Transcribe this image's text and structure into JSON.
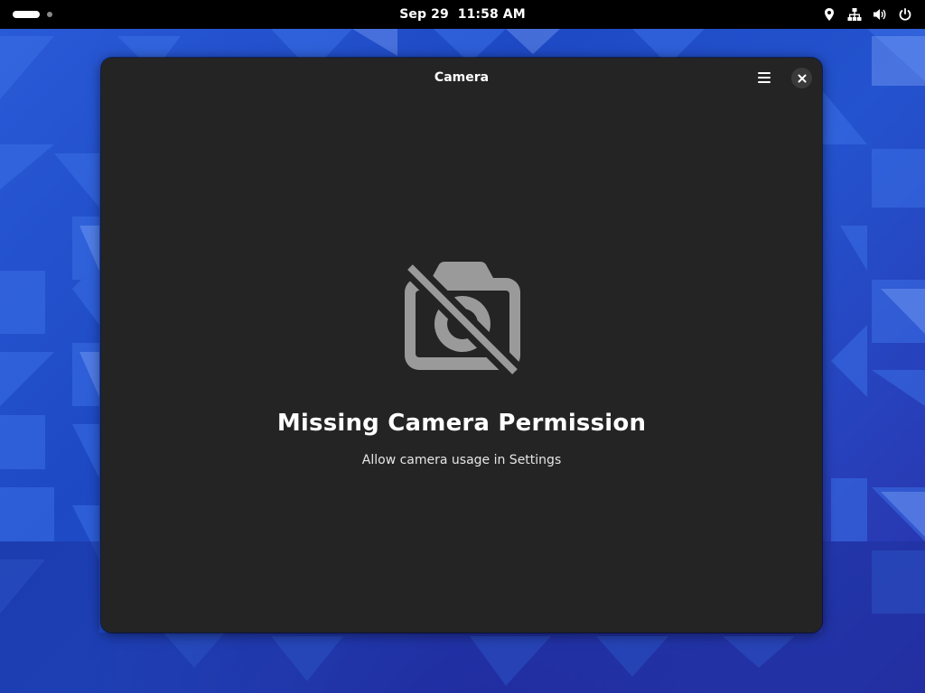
{
  "topbar": {
    "date": "Sep 29",
    "time": "11:58 AM",
    "tray_icons": [
      "location-icon",
      "network-wired-icon",
      "volume-icon",
      "power-icon"
    ]
  },
  "window": {
    "title": "Camera",
    "menu_icon": "hamburger-menu-icon",
    "close_icon": "close-icon"
  },
  "status": {
    "icon": "camera-disabled-icon",
    "title": "Missing Camera Permission",
    "description": "Allow camera usage in Settings"
  },
  "colors": {
    "window_bg": "#242424",
    "topbar_bg": "#000000",
    "wallpaper_blue": "#2453cf",
    "icon_gray": "#9a9a9a"
  }
}
